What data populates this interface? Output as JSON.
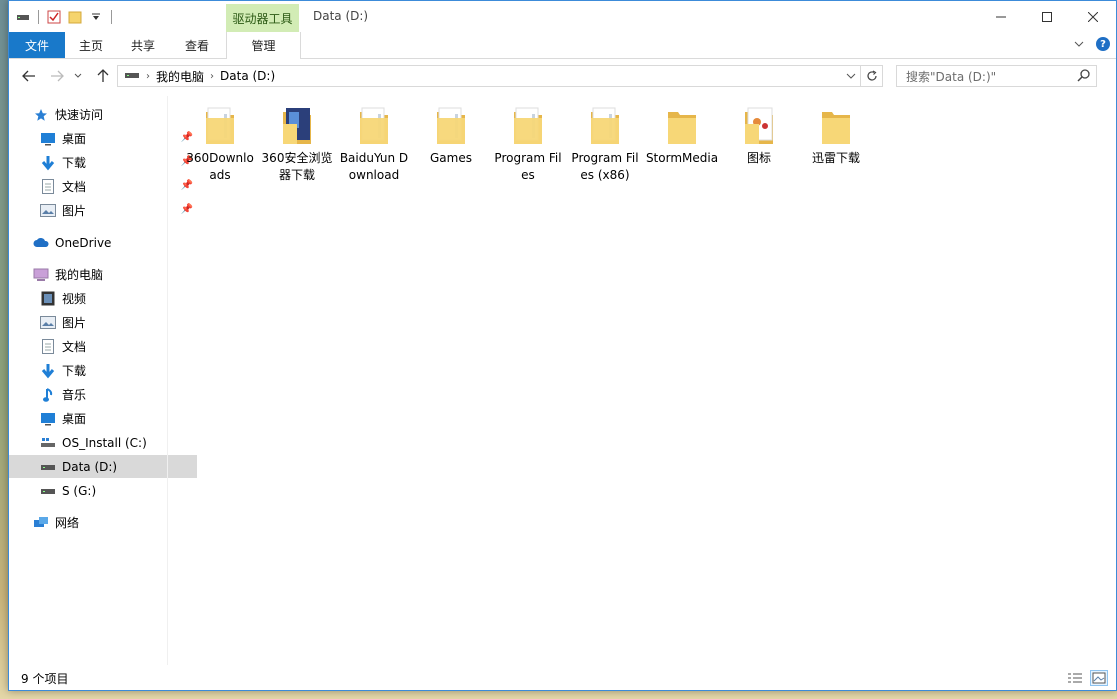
{
  "window": {
    "title": "Data (D:)",
    "tools_header": "驱动器工具"
  },
  "ribbon": {
    "tabs": [
      {
        "label": "文件"
      },
      {
        "label": "主页"
      },
      {
        "label": "共享"
      },
      {
        "label": "查看"
      },
      {
        "label": "管理"
      }
    ]
  },
  "address": {
    "crumbs": [
      "我的电脑",
      "Data (D:)"
    ]
  },
  "search": {
    "placeholder": "搜索\"Data (D:)\""
  },
  "sidebar": {
    "items": [
      {
        "label": "快速访问",
        "icon": "star-icon"
      },
      {
        "label": "桌面",
        "icon": "desktop-icon",
        "pinned": true
      },
      {
        "label": "下载",
        "icon": "download-icon",
        "pinned": true
      },
      {
        "label": "文档",
        "icon": "document-icon",
        "pinned": true
      },
      {
        "label": "图片",
        "icon": "pictures-icon",
        "pinned": true
      },
      {
        "label": "OneDrive",
        "icon": "cloud-icon"
      },
      {
        "label": "我的电脑",
        "icon": "computer-icon"
      },
      {
        "label": "视频",
        "icon": "video-icon"
      },
      {
        "label": "图片",
        "icon": "pictures-icon"
      },
      {
        "label": "文档",
        "icon": "document-icon"
      },
      {
        "label": "下载",
        "icon": "download-icon"
      },
      {
        "label": "音乐",
        "icon": "music-icon"
      },
      {
        "label": "桌面",
        "icon": "desktop-icon"
      },
      {
        "label": "OS_Install (C:)",
        "icon": "os-drive-icon"
      },
      {
        "label": "Data (D:)",
        "icon": "drive-icon",
        "selected": true
      },
      {
        "label": "S (G:)",
        "icon": "drive-icon"
      },
      {
        "label": "网络",
        "icon": "network-icon"
      }
    ]
  },
  "folders": [
    {
      "label": "360Downloads"
    },
    {
      "label": "360安全浏览器下载"
    },
    {
      "label": "BaiduYun Download"
    },
    {
      "label": "Games"
    },
    {
      "label": "Program Files"
    },
    {
      "label": "Program Files (x86)"
    },
    {
      "label": "StormMedia"
    },
    {
      "label": "图标"
    },
    {
      "label": "迅雷下载"
    }
  ],
  "status": {
    "count_text": "9 个项目"
  },
  "colors": {
    "accent": "#1979ca",
    "tools_tab": "#d2ecb5",
    "folder": "#f5d46d"
  }
}
